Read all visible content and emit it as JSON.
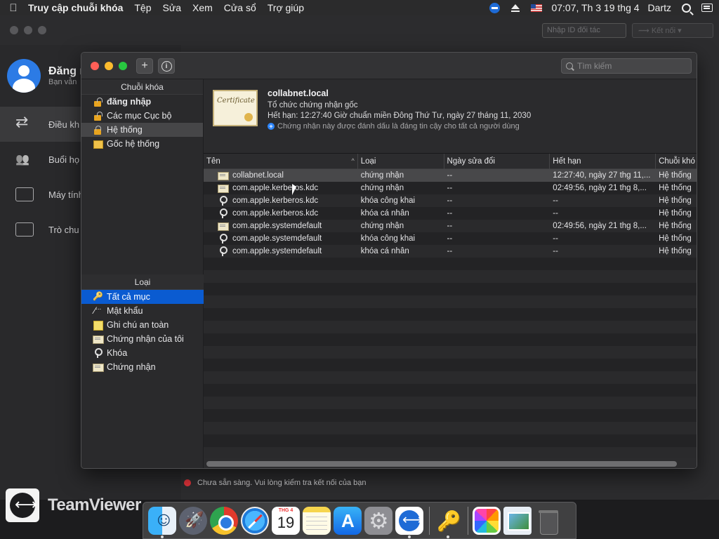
{
  "menubar": {
    "app_name": "Truy cập chuỗi khóa",
    "menus": [
      "Tệp",
      "Sửa",
      "Xem",
      "Cửa sổ",
      "Trợ giúp"
    ],
    "clock": "07:07, Th 3 19 thg 4",
    "user": "Dartz"
  },
  "teamviewer": {
    "partner_id_placeholder": "Nhập ID đối tác",
    "connect_label": "Kết nối",
    "profile_name": "Đăng n",
    "profile_sub": "Bạn vẫn",
    "nav": [
      "Điều kh",
      "Buổi họ",
      "Máy tính",
      "Trò chu"
    ],
    "logo_text": "TeamViewer",
    "status": "Chưa sẵn sàng. Vui lòng kiểm tra kết nối của bạn"
  },
  "keychain": {
    "search_placeholder": "Tìm kiếm",
    "keychains_header": "Chuỗi khóa",
    "keychains": [
      {
        "label": "đăng nhập",
        "icon": "open-lock-icon",
        "bold": true
      },
      {
        "label": "Các mục Cục bộ",
        "icon": "open-lock-icon",
        "bold": false
      },
      {
        "label": "Hệ thống",
        "icon": "lock-icon",
        "bold": false
      },
      {
        "label": "Gốc hệ thống",
        "icon": "folder-icon",
        "bold": false
      }
    ],
    "category_header": "Loại",
    "categories": [
      {
        "label": "Tất cả mục",
        "icon": "all-items-icon"
      },
      {
        "label": "Mật khẩu",
        "icon": "password-icon"
      },
      {
        "label": "Ghi chú an toàn",
        "icon": "note-icon"
      },
      {
        "label": "Chứng nhận của tôi",
        "icon": "my-cert-icon"
      },
      {
        "label": "Khóa",
        "icon": "key-icon"
      },
      {
        "label": "Chứng nhận",
        "icon": "cert-icon"
      }
    ],
    "detail": {
      "title": "collabnet.local",
      "subtitle": "Tổ chức chứng nhận gốc",
      "expiry": "Hết hạn: 12:27:40 Giờ chuẩn miền Đông Thứ Tư, ngày 27 tháng 11, 2030",
      "trust": "Chứng nhận này được đánh dấu là đáng tin cậy cho tất cả người dùng"
    },
    "columns": [
      "Tên",
      "Loại",
      "Ngày sửa đổi",
      "Hết hạn",
      "Chuỗi khó"
    ],
    "rows": [
      {
        "name": "collabnet.local",
        "type": "chứng nhận",
        "modified": "--",
        "expires": "12:27:40, ngày 27 thg 11,...",
        "keychain": "Hệ thống",
        "icon": "cert-icon"
      },
      {
        "name": "com.apple.kerberos.kdc",
        "type": "chứng nhận",
        "modified": "--",
        "expires": "02:49:56, ngày 21 thg 8,...",
        "keychain": "Hệ thống",
        "icon": "cert-icon"
      },
      {
        "name": "com.apple.kerberos.kdc",
        "type": "khóa công khai",
        "modified": "--",
        "expires": "--",
        "keychain": "Hệ thống",
        "icon": "key-icon"
      },
      {
        "name": "com.apple.kerberos.kdc",
        "type": "khóa cá nhân",
        "modified": "--",
        "expires": "--",
        "keychain": "Hệ thống",
        "icon": "key-icon"
      },
      {
        "name": "com.apple.systemdefault",
        "type": "chứng nhận",
        "modified": "--",
        "expires": "02:49:56, ngày 21 thg 8,...",
        "keychain": "Hệ thống",
        "icon": "cert-icon"
      },
      {
        "name": "com.apple.systemdefault",
        "type": "khóa công khai",
        "modified": "--",
        "expires": "--",
        "keychain": "Hệ thống",
        "icon": "key-icon"
      },
      {
        "name": "com.apple.systemdefault",
        "type": "khóa cá nhân",
        "modified": "--",
        "expires": "--",
        "keychain": "Hệ thống",
        "icon": "key-icon"
      }
    ]
  },
  "dock": {
    "calendar_month": "THG 4",
    "calendar_day": "19"
  }
}
